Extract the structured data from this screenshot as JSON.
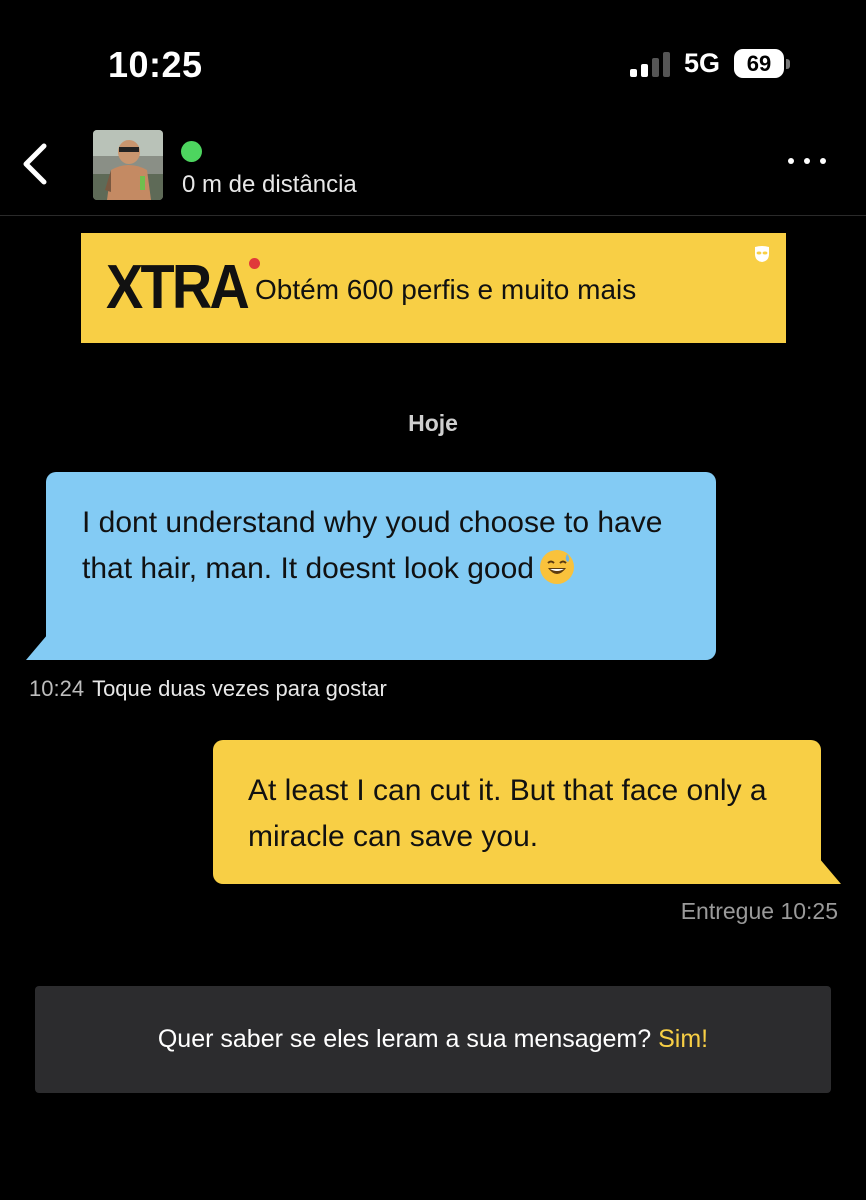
{
  "status_bar": {
    "time": "10:25",
    "network": "5G",
    "battery": "69"
  },
  "header": {
    "distance": "0 m de distância",
    "online_color": "#4dd55f"
  },
  "banner": {
    "brand": "XTRA",
    "text": "Obtém 600 perfis e muito mais",
    "color": "#f8cf45"
  },
  "chat": {
    "day_label": "Hoje",
    "messages": [
      {
        "direction": "incoming",
        "text": "I dont understand why youd choose to have that hair, man. It doesnt look good",
        "emoji": "grinning-sweat-emoji",
        "time": "10:24",
        "hint": "Toque duas vezes para gostar"
      },
      {
        "direction": "outgoing",
        "text": "At least I can cut it. But that face only a miracle can save you.",
        "status": "Entregue 10:25"
      }
    ]
  },
  "read_prompt": {
    "question": "Quer saber se eles leram a sua mensagem?",
    "action": "Sim!"
  }
}
